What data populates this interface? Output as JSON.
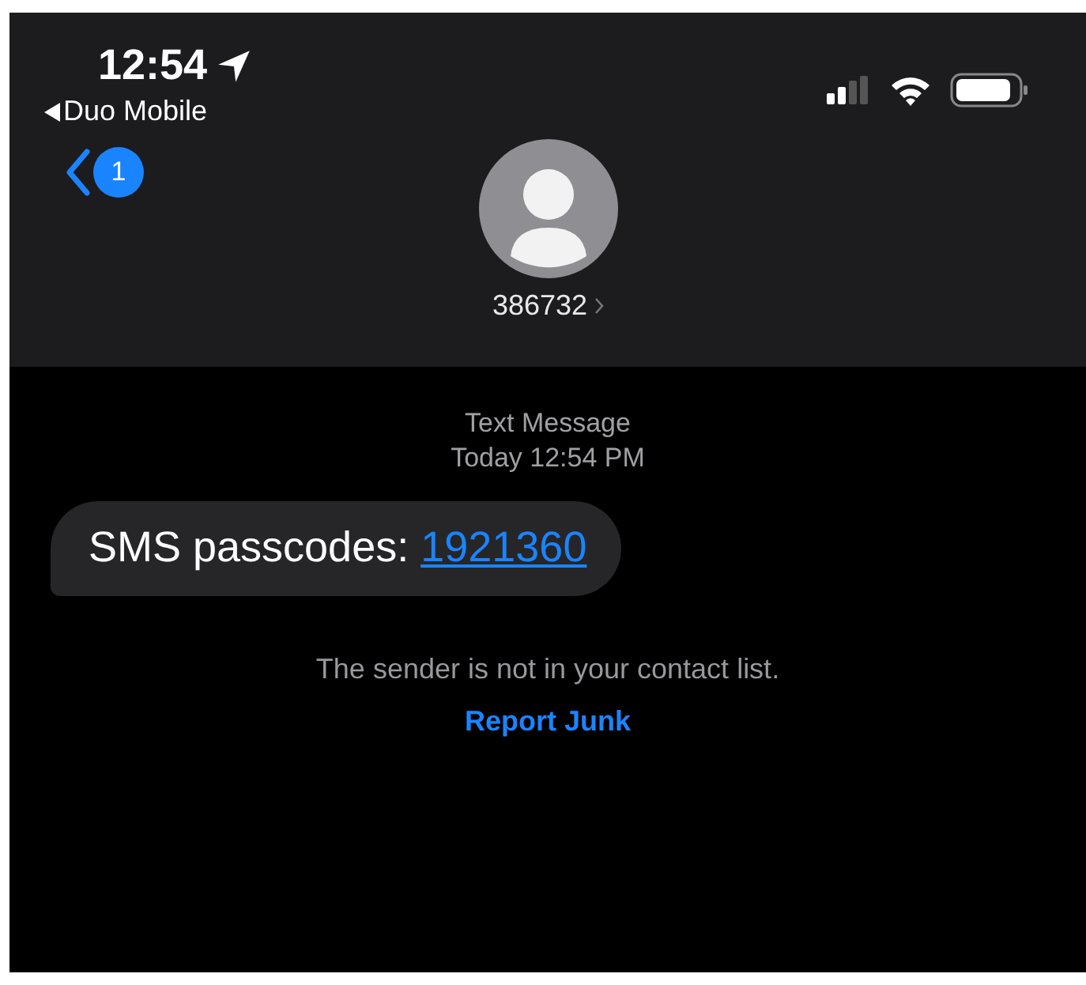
{
  "status_bar": {
    "time": "12:54",
    "back_app": "Duo Mobile"
  },
  "nav": {
    "unread_count": "1",
    "contact": "386732"
  },
  "conversation": {
    "service": "Text Message",
    "timestamp": "Today 12:54 PM",
    "messages": [
      {
        "text": "SMS passcodes: ",
        "link": "1921360"
      }
    ],
    "notice": "The sender is not in your contact list.",
    "action": "Report Junk"
  }
}
